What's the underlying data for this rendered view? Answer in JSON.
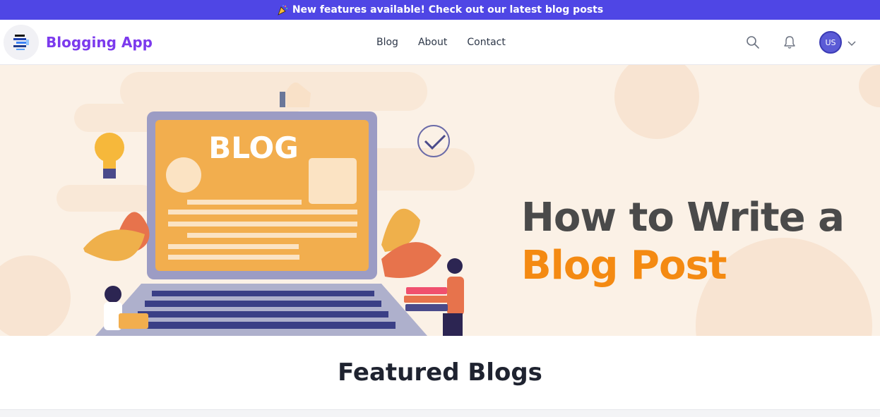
{
  "announcement": {
    "icon": "party-popper-icon",
    "text": "New features available! Check out our latest blog posts"
  },
  "header": {
    "brand": "Blogging App",
    "nav": [
      {
        "label": "Blog"
      },
      {
        "label": "About"
      },
      {
        "label": "Contact"
      }
    ],
    "avatar_initials": "US"
  },
  "hero": {
    "image_label": "BLOG",
    "title_line1": "How to Write a",
    "title_line2": "Blog Post"
  },
  "featured": {
    "heading": "Featured Blogs"
  },
  "colors": {
    "accent": "#4f46e5",
    "brand": "#7c3aed",
    "hero_orange": "#f48a12",
    "hero_bg": "#fbf1e6"
  }
}
